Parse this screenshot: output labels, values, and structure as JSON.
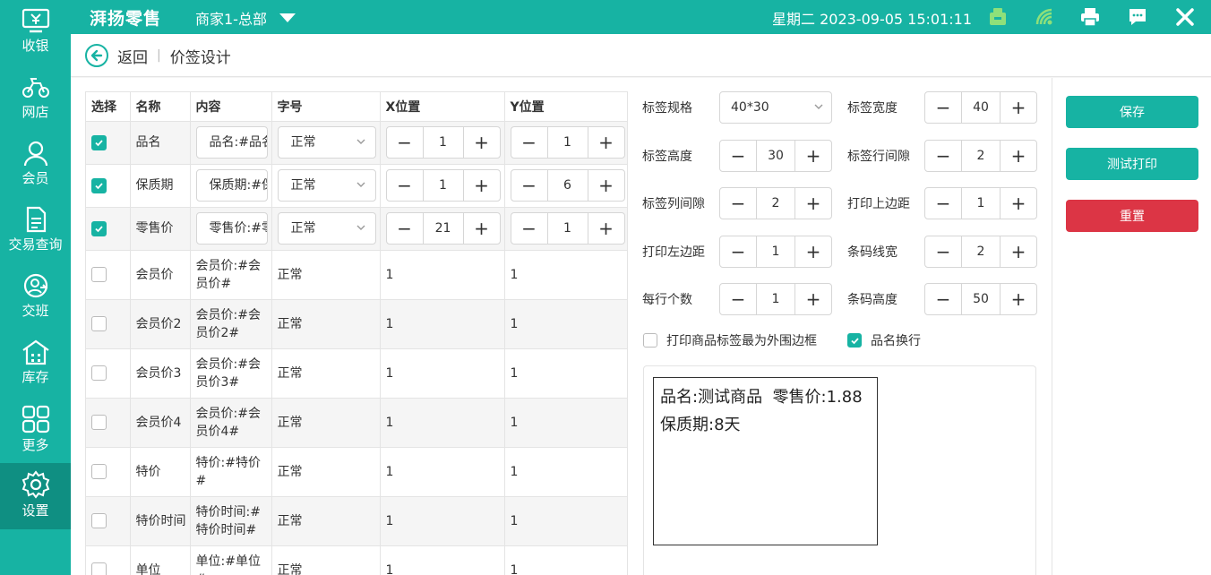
{
  "app": {
    "brand": "湃扬零售",
    "store": "商家1-总部",
    "datetime": "星期二 2023-09-05 15:01:11"
  },
  "sidebar": {
    "items": [
      {
        "label": "收银",
        "icon": "cashier-icon"
      },
      {
        "label": "网店",
        "icon": "bike-icon"
      },
      {
        "label": "会员",
        "icon": "member-icon"
      },
      {
        "label": "交易查询",
        "icon": "document-icon"
      },
      {
        "label": "交班",
        "icon": "handover-icon"
      },
      {
        "label": "库存",
        "icon": "warehouse-icon"
      },
      {
        "label": "更多",
        "icon": "grid-icon"
      },
      {
        "label": "设置",
        "icon": "gear-icon",
        "active": true
      }
    ]
  },
  "header": {
    "back_label": "返回",
    "sep": "|",
    "title": "价签设计"
  },
  "table": {
    "headers": [
      "选择",
      "名称",
      "内容",
      "字号",
      "X位置",
      "Y位置"
    ],
    "rows": [
      {
        "checked": true,
        "name": "品名",
        "content": "品名:#品名#",
        "size": "正常",
        "x": "1",
        "y": "1",
        "editable": true
      },
      {
        "checked": true,
        "name": "保质期",
        "content": "保质期:#保质期#",
        "size": "正常",
        "x": "1",
        "y": "6",
        "editable": true
      },
      {
        "checked": true,
        "name": "零售价",
        "content": "零售价:#零售价#",
        "size": "正常",
        "x": "21",
        "y": "1",
        "editable": true
      },
      {
        "checked": false,
        "name": "会员价",
        "content": "会员价:#会员价#",
        "size": "正常",
        "x": "1",
        "y": "1",
        "editable": false
      },
      {
        "checked": false,
        "name": "会员价2",
        "content": "会员价:#会员价2#",
        "size": "正常",
        "x": "1",
        "y": "1",
        "editable": false
      },
      {
        "checked": false,
        "name": "会员价3",
        "content": "会员价:#会员价3#",
        "size": "正常",
        "x": "1",
        "y": "1",
        "editable": false
      },
      {
        "checked": false,
        "name": "会员价4",
        "content": "会员价:#会员价4#",
        "size": "正常",
        "x": "1",
        "y": "1",
        "editable": false
      },
      {
        "checked": false,
        "name": "特价",
        "content": "特价:#特价#",
        "size": "正常",
        "x": "1",
        "y": "1",
        "editable": false
      },
      {
        "checked": false,
        "name": "特价时间",
        "content": "特价时间:#特价时间#",
        "size": "正常",
        "x": "1",
        "y": "1",
        "editable": false
      },
      {
        "checked": false,
        "name": "单位",
        "content": "单位:#单位#",
        "size": "正常",
        "x": "1",
        "y": "1",
        "editable": false
      }
    ]
  },
  "settings": {
    "spec_label": "标签规格",
    "spec_value": "40*30",
    "width_label": "标签宽度",
    "width_value": "40",
    "height_label": "标签高度",
    "height_value": "30",
    "row_gap_label": "标签行间隙",
    "row_gap_value": "2",
    "col_gap_label": "标签列间隙",
    "col_gap_value": "2",
    "top_margin_label": "打印上边距",
    "top_margin_value": "1",
    "left_margin_label": "打印左边距",
    "left_margin_value": "1",
    "barcode_width_label": "条码线宽",
    "barcode_width_value": "2",
    "per_row_label": "每行个数",
    "per_row_value": "1",
    "barcode_height_label": "条码高度",
    "barcode_height_value": "50",
    "outer_border_label": "打印商品标签最为外围边框",
    "outer_border_checked": false,
    "wrap_label": "品名换行",
    "wrap_checked": true
  },
  "preview": {
    "line1": "品名:测试商品  零售价:1.88",
    "line2": "保质期:8天"
  },
  "actions": {
    "save": "保存",
    "test_print": "测试打印",
    "reset": "重置"
  },
  "colors": {
    "primary": "#17b3a3",
    "danger": "#dc3545"
  }
}
